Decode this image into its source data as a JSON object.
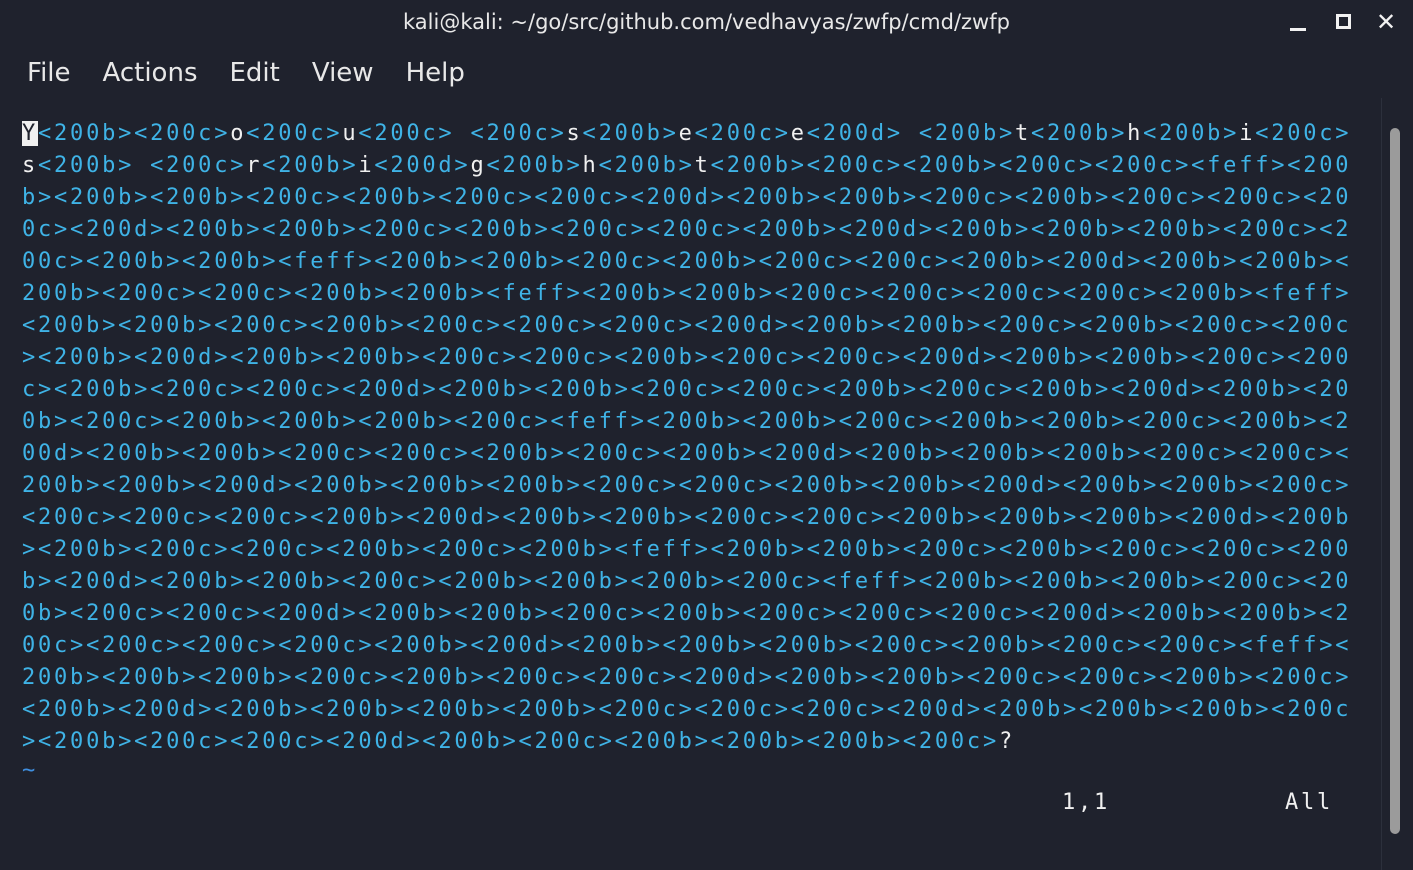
{
  "window": {
    "title": "kali@kali: ~/go/src/github.com/vedhavyas/zwfp/cmd/zwfp",
    "minimize_icon": "minimize-icon",
    "maximize_icon": "maximize-icon",
    "close_icon": "close-icon",
    "close_glyph": "✕"
  },
  "menu": [
    "File",
    "Actions",
    "Edit",
    "View",
    "Help"
  ],
  "editor": {
    "lines": [
      "Y<200b><200c>o<200c>u<200c> <200c>s<200b>e<200c>e<200d> <200b>t<200b>h<200b>i<200c>",
      "s<200b> <200c>r<200b>i<200d>g<200b>h<200b>t<200b><200c><200b><200c><200c><feff><200",
      "b><200b><200b><200c><200b><200c><200c><200d><200b><200b><200c><200b><200c><200c><20",
      "0c><200d><200b><200b><200c><200b><200c><200c><200b><200d><200b><200b><200b><200c><2",
      "00c><200b><200b><feff><200b><200b><200c><200b><200c><200c><200b><200d><200b><200b><",
      "200b><200c><200c><200b><200b><feff><200b><200b><200c><200c><200c><200c><200b><feff>",
      "<200b><200b><200c><200b><200c><200c><200c><200d><200b><200b><200c><200b><200c><200c",
      "><200b><200d><200b><200b><200c><200c><200b><200c><200c><200d><200b><200b><200c><200",
      "c><200b><200c><200c><200d><200b><200b><200c><200c><200b><200c><200b><200d><200b><20",
      "0b><200c><200b><200b><200b><200c><feff><200b><200b><200c><200b><200b><200c><200b><2",
      "00d><200b><200b><200c><200c><200b><200c><200b><200d><200b><200b><200b><200c><200c><",
      "200b><200b><200d><200b><200b><200b><200c><200c><200b><200b><200d><200b><200b><200c>",
      "<200c><200c><200c><200b><200d><200b><200b><200c><200c><200b><200b><200b><200d><200b",
      "><200b><200c><200c><200b><200c><200b><feff><200b><200b><200c><200b><200c><200c><200",
      "b><200d><200b><200b><200c><200b><200b><200b><200c><feff><200b><200b><200b><200c><20",
      "0b><200c><200c><200d><200b><200b><200c><200b><200c><200c><200c><200d><200b><200b><2",
      "00c><200c><200c><200c><200b><200d><200b><200b><200b><200c><200b><200c><200c><feff><",
      "200b><200b><200b><200c><200b><200c><200c><200d><200b><200b><200c><200c><200b><200c>",
      "<200b><200d><200b><200b><200b><200b><200c><200c><200c><200d><200b><200b><200b><200c",
      "><200b><200c><200c><200d><200b><200c><200b><200b><200b><200c>?"
    ],
    "empty_line_marker": "~",
    "cursor_position": "1,1",
    "scroll_position": "All"
  },
  "colors": {
    "background": "#1f222d",
    "special_char": "#3fb3e6",
    "text": "#f0f0f0",
    "tilde": "#3f8fe0"
  }
}
